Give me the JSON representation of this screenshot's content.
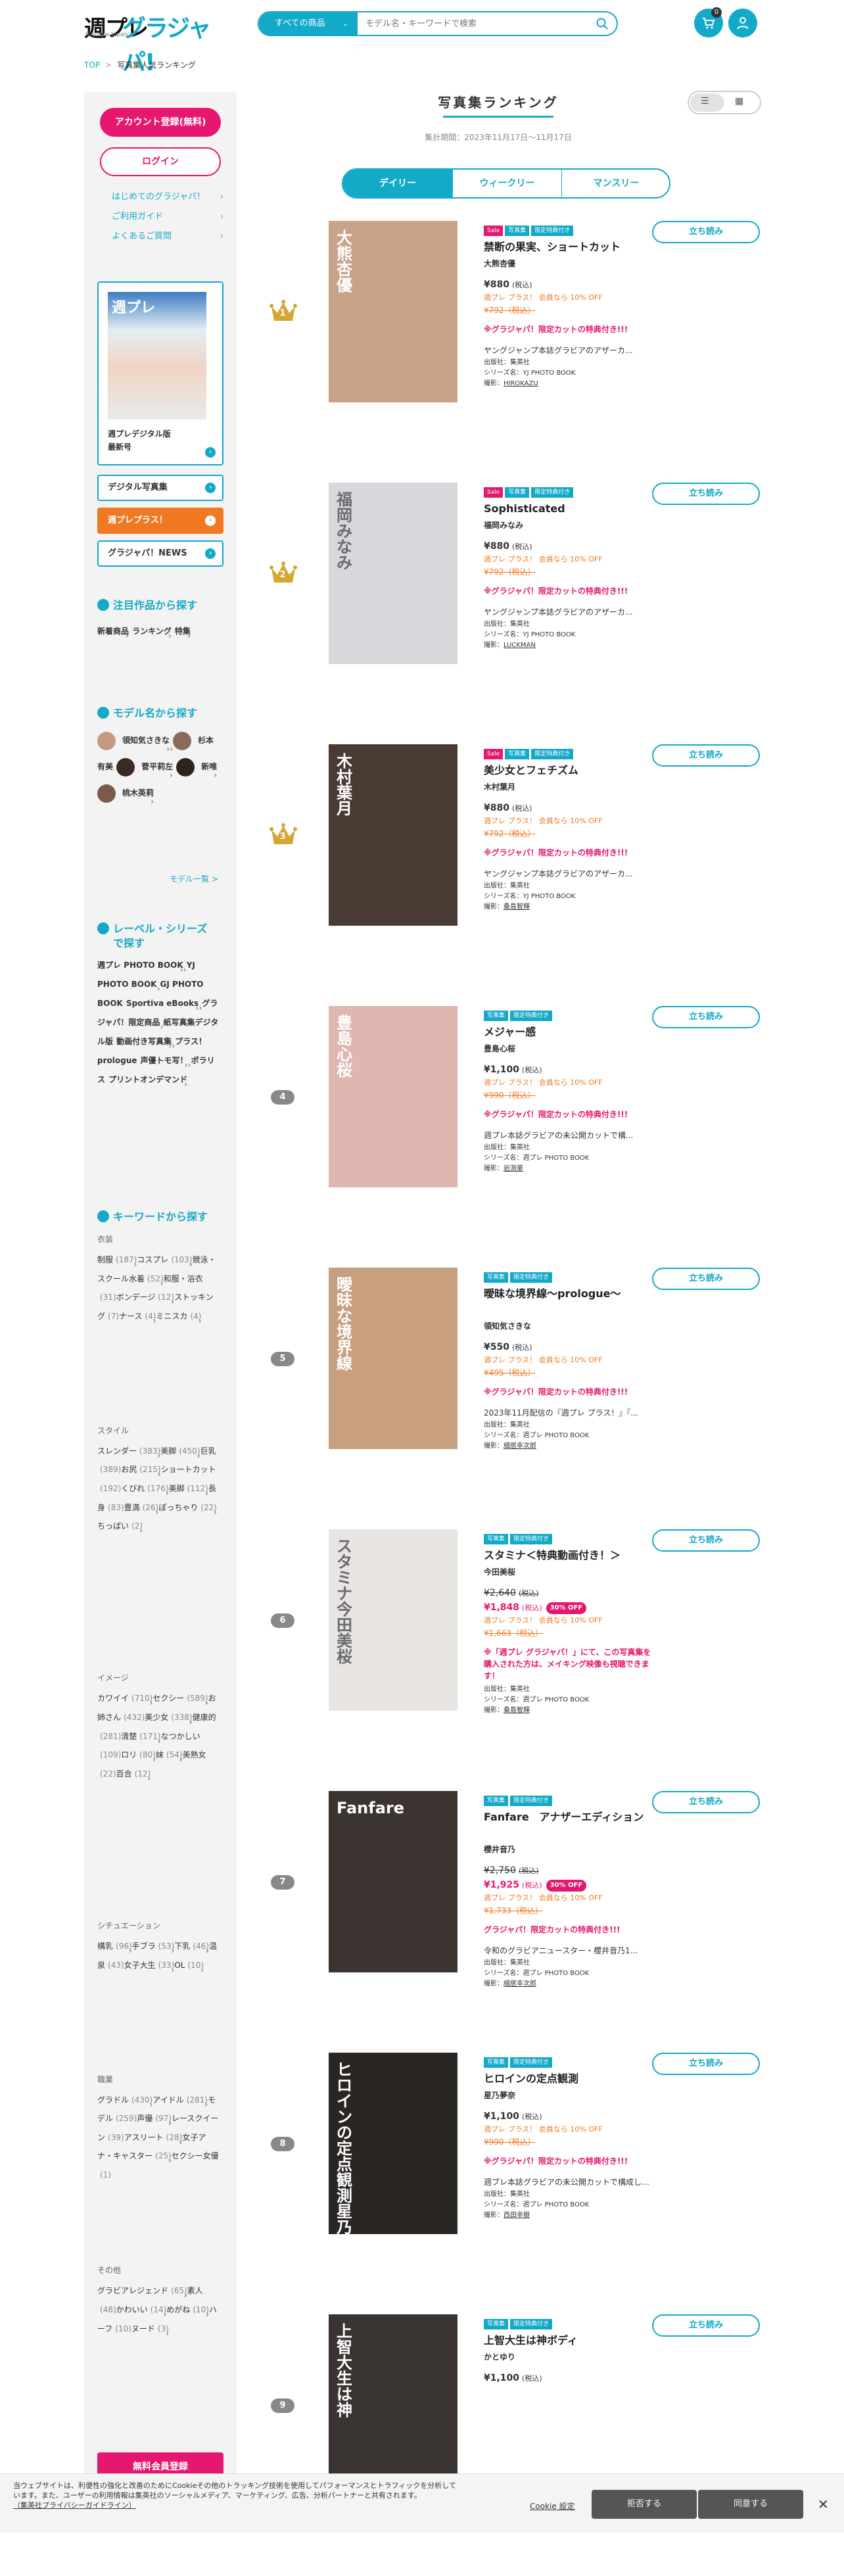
{
  "header": {
    "logo_main": "週プレ",
    "logo_brand": "グラジャパ!",
    "logo_sub": "Gravure Japan",
    "search_category": "すべての商品",
    "search_placeholder": "モデル名・キーワードで検索",
    "cart_count": "0"
  },
  "breadcrumb": {
    "top": "TOP",
    "sep": ">",
    "current": "写真集人気ランキング"
  },
  "sidebar": {
    "register": "アカウント登録(無料)",
    "login": "ログイン",
    "links": [
      "はじめてのグラジャパ！",
      "ご利用ガイド",
      "よくあるご質問"
    ],
    "mag_title": "週プレ",
    "mag_caption_1": "週プレデジタル版",
    "mag_caption_2": "最新号",
    "boxes": [
      "デジタル写真集",
      "週プレプラス！",
      "グラジャパ！NEWS"
    ],
    "focus_heading": "注目作品から探す",
    "focus_items": [
      "新着商品",
      "ランキング",
      "特集"
    ],
    "model_heading": "モデル名から探す",
    "models": [
      "領知気さきな",
      "杉本有美",
      "菅平莉左",
      "新唯",
      "桃木英莉"
    ],
    "model_more": "モデル一覧 >",
    "label_heading": "レーベル・シリーズ",
    "label_heading_2": "で探す",
    "labels": [
      "週プレ PHOTO BOOK",
      "YJ PHOTO BOOK",
      "GJ PHOTO BOOK",
      "Sportiva eBooks",
      "グラジャパ！限定商品",
      "紙写真集デジタル版",
      "動画付き写真集",
      "プラス！prologue",
      "声優トモ写！",
      "ポラリス",
      "プリントオンデマンド"
    ],
    "keyword_heading": "キーワードから探す",
    "kw_groups": [
      {
        "name": "衣装",
        "items": [
          [
            "制服",
            "187"
          ],
          [
            "コスプレ",
            "103"
          ],
          [
            "競泳・スクール水着",
            "52"
          ],
          [
            "和服・浴衣",
            "31"
          ],
          [
            "ボンデージ",
            "12"
          ],
          [
            "ストッキング",
            "7"
          ],
          [
            "ナース",
            "4"
          ],
          [
            "ミニスカ",
            "4"
          ]
        ]
      },
      {
        "name": "スタイル",
        "items": [
          [
            "スレンダー",
            "383"
          ],
          [
            "美脚",
            "450"
          ],
          [
            "巨乳",
            "389"
          ],
          [
            "お尻",
            "215"
          ],
          [
            "ショートカット",
            "192"
          ],
          [
            "くびれ",
            "176"
          ],
          [
            "美脚",
            "112"
          ],
          [
            "長身",
            "83"
          ],
          [
            "豊満",
            "26"
          ],
          [
            "ぽっちゃり",
            "22"
          ],
          [
            "ちっぱい",
            "2"
          ]
        ]
      },
      {
        "name": "イメージ",
        "items": [
          [
            "カワイイ",
            "710"
          ],
          [
            "セクシー",
            "589"
          ],
          [
            "お姉さん",
            "432"
          ],
          [
            "美少女",
            "338"
          ],
          [
            "健康的",
            "281"
          ],
          [
            "清楚",
            "171"
          ],
          [
            "なつかしい",
            "109"
          ],
          [
            "ロリ",
            "80"
          ],
          [
            "妹",
            "54"
          ],
          [
            "美熟女",
            "22"
          ],
          [
            "百合",
            "12"
          ]
        ]
      },
      {
        "name": "シチュエーション",
        "items": [
          [
            "構乳",
            "96"
          ],
          [
            "手ブラ",
            "53"
          ],
          [
            "下乳",
            "46"
          ],
          [
            "温泉",
            "43"
          ],
          [
            "女子大生",
            "33"
          ],
          [
            "OL",
            "10"
          ]
        ]
      },
      {
        "name": "職業",
        "items": [
          [
            "グラドル",
            "430"
          ],
          [
            "アイドル",
            "281"
          ],
          [
            "モデル",
            "259"
          ],
          [
            "声優",
            "97"
          ],
          [
            "レースクイーン",
            "39"
          ],
          [
            "アスリート",
            "28"
          ],
          [
            "女子アナ・キャスター",
            "25"
          ],
          [
            "セクシー女優",
            "1"
          ]
        ]
      },
      {
        "name": "その他",
        "items": [
          [
            "グラビアレジェンド",
            "65"
          ],
          [
            "素人",
            "48"
          ],
          [
            "かわいい",
            "14"
          ],
          [
            "めがね",
            "10"
          ],
          [
            "ハーフ",
            "10"
          ],
          [
            "ヌード",
            "3"
          ]
        ]
      }
    ],
    "cta": "無料会員登録"
  },
  "main": {
    "title": "写真集ランキング",
    "period": "集計期間：2023年11月17日～11月17日",
    "tabs": [
      "デイリー",
      "ウィークリー",
      "マンスリー"
    ],
    "read_label": "立ち読み",
    "items": [
      {
        "rank": "1",
        "tags": [
          "Sale",
          "写真集",
          "限定特典付き"
        ],
        "title": "禁断の果実、ショートカット",
        "author": "大熊杏優",
        "price": "¥880",
        "tax": "(税込)",
        "plus": "週プレ プラス！ 会員なら 10% OFF",
        "dprice": "¥792（税込）",
        "note": "※グラジャパ！限定カットの特典付き!!!",
        "desc": "ヤングジャンプ本誌グラビアのアザーカ...",
        "pub": "出版社：集英社",
        "series": "シリーズ名：YJ PHOTO BOOK",
        "photo": "撮影：",
        "photog": "HIROKAZU",
        "cover_text": "大熊杏優",
        "cover_bg": "#c9a28a"
      },
      {
        "rank": "2",
        "tags": [
          "Sale",
          "写真集",
          "限定特典付き"
        ],
        "title": "Sophisticated",
        "author": "福岡みなみ",
        "price": "¥880",
        "tax": "(税込)",
        "plus": "週プレ プラス！ 会員なら 10% OFF",
        "dprice": "¥792（税込）",
        "note": "※グラジャパ！限定カットの特典付き!!!",
        "desc": "ヤングジャンプ本誌グラビアのアザーカ...",
        "pub": "出版社：集英社",
        "series": "シリーズ名：YJ PHOTO BOOK",
        "photo": "撮影：",
        "photog": "LUCKMAN",
        "cover_text": "福岡みなみ",
        "cover_bg": "#d8d8dc"
      },
      {
        "rank": "3",
        "tags": [
          "Sale",
          "写真集",
          "限定特典付き"
        ],
        "title": "美少女とフェチズム",
        "author": "木村葉月",
        "price": "¥880",
        "tax": "(税込)",
        "plus": "週プレ プラス！ 会員なら 10% OFF",
        "dprice": "¥792（税込）",
        "note": "※グラジャパ！限定カットの特典付き!!!",
        "desc": "ヤングジャンプ本誌グラビアのアザーカ...",
        "pub": "出版社：集英社",
        "series": "シリーズ名：YJ PHOTO BOOK",
        "photo": "撮影：",
        "photog": "桑島智輝",
        "cover_text": "木村葉月",
        "cover_bg": "#4a3a34"
      },
      {
        "rank": "4",
        "tags": [
          "写真集",
          "限定特典付き"
        ],
        "title": "メジャー感",
        "author": "豊島心桜",
        "price": "¥1,100",
        "tax": "(税込)",
        "plus": "週プレ プラス！ 会員なら 10% OFF",
        "dprice": "¥990（税込）",
        "note": "※グラジャパ！限定カットの特典付き!!!",
        "desc": "週プレ本誌グラビアの未公開カットで構...",
        "pub": "出版社：集英社",
        "series": "シリーズ名：週プレ PHOTO BOOK",
        "photo": "撮影：",
        "photog": "岩渕豪",
        "cover_text": "豊島心桜",
        "cover_bg": "#e0b6b0"
      },
      {
        "rank": "5",
        "tags": [
          "写真集",
          "限定特典付き"
        ],
        "title": "曖昧な境界線〜prologue〜",
        "author": "領知気さきな",
        "price": "¥550",
        "tax": "(税込)",
        "plus": "週プレ プラス！ 会員なら 10% OFF",
        "dprice": "¥495（税込）",
        "note": "※グラジャパ！限定カットの特典付き!!!",
        "desc": "2023年11月配信の『週プレ プラス！』『...",
        "pub": "出版社：集英社",
        "series": "シリーズ名：週プレ PHOTO BOOK",
        "photo": "撮影：",
        "photog": "細居幸次郎",
        "cover_text": "曖昧な境界線",
        "cover_bg": "#c8a080"
      },
      {
        "rank": "6",
        "tags": [
          "写真集",
          "限定特典付き"
        ],
        "title": "スタミナ＜特典動画付き！＞",
        "author": "今田美桜",
        "price_old": "¥2,640",
        "price": "¥1,848",
        "tax": "(税込)",
        "off": "30% OFF",
        "plus": "週プレ プラス！ 会員なら 10% OFF",
        "dprice": "¥1,663（税込）",
        "note": "※「週プレ グラジャパ！」にて、この写真集を購入された方は、メイキング映像も視聴できます！",
        "desc": "",
        "pub": "出版社：集英社",
        "series": "シリーズ名：週プレ PHOTO BOOK",
        "photo": "撮影：",
        "photog": "桑島智輝",
        "cover_text": "スタミナ 今田美桜",
        "cover_bg": "#e8e4e2"
      },
      {
        "rank": "7",
        "tags": [
          "写真集",
          "限定特典付き"
        ],
        "title": "Fanfare　アナザーエディション",
        "author": "櫻井音乃",
        "price_old": "¥2,750",
        "price": "¥1,925",
        "tax": "(税込)",
        "off": "30% OFF",
        "plus": "週プレ プラス！ 会員なら 10% OFF",
        "dprice": "¥1,733（税込）",
        "note": "グラジャパ！限定カットの特典付き!!!",
        "desc": "令和のグラビアニュースター・櫻井音乃1...",
        "pub": "出版社：集英社",
        "series": "シリーズ名：週プレ PHOTO BOOK",
        "photo": "撮影：",
        "photog": "細居幸次郎",
        "cover_text": "Fanfare",
        "cover_bg": "#3c3430"
      },
      {
        "rank": "8",
        "tags": [
          "写真集",
          "限定特典付き"
        ],
        "title": "ヒロインの定点観測",
        "author": "星乃夢奈",
        "price": "¥1,100",
        "tax": "(税込)",
        "plus": "週プレ プラス！ 会員なら 10% OFF",
        "dprice": "¥990（税込）",
        "note": "※グラジャパ！限定カットの特典付き!!!",
        "desc": "週プレ本誌グラビアの未公開カットで構成したデジタル写真集！...",
        "pub": "出版社：集英社",
        "series": "シリーズ名：週プレ PHOTO BOOK",
        "photo": "撮影：",
        "photog": "西田幸樹",
        "cover_text": "ヒロインの定点観測 星乃夢奈",
        "cover_bg": "#2a2624"
      },
      {
        "rank": "9",
        "tags": [
          "写真集",
          "限定特典付き"
        ],
        "title": "上智大生は神ボディ",
        "author": "かとゆり",
        "price": "¥1,100",
        "tax": "(税込)",
        "cover_text": "上智大生は神",
        "cover_bg": "#3a3532"
      }
    ]
  },
  "cookie": {
    "text": "当ウェブサイトは、利便性の強化と改善のためにCookieその他のトラッキング技術を使用してパフォーマンスとトラフィックを分析しています。また、ユーザーの利用情報は集英社のソーシャルメディア、マーケティング、広告、分析パートナーと共有されます。",
    "link": "（集英社プライバシーガイドライン）",
    "settings": "Cookie 設定",
    "reject": "拒否する",
    "accept": "同意する"
  },
  "colors": {
    "accent": "#13a9c9",
    "pink": "#e5176f",
    "orange": "#f07a24",
    "crown": "#d4a632"
  }
}
